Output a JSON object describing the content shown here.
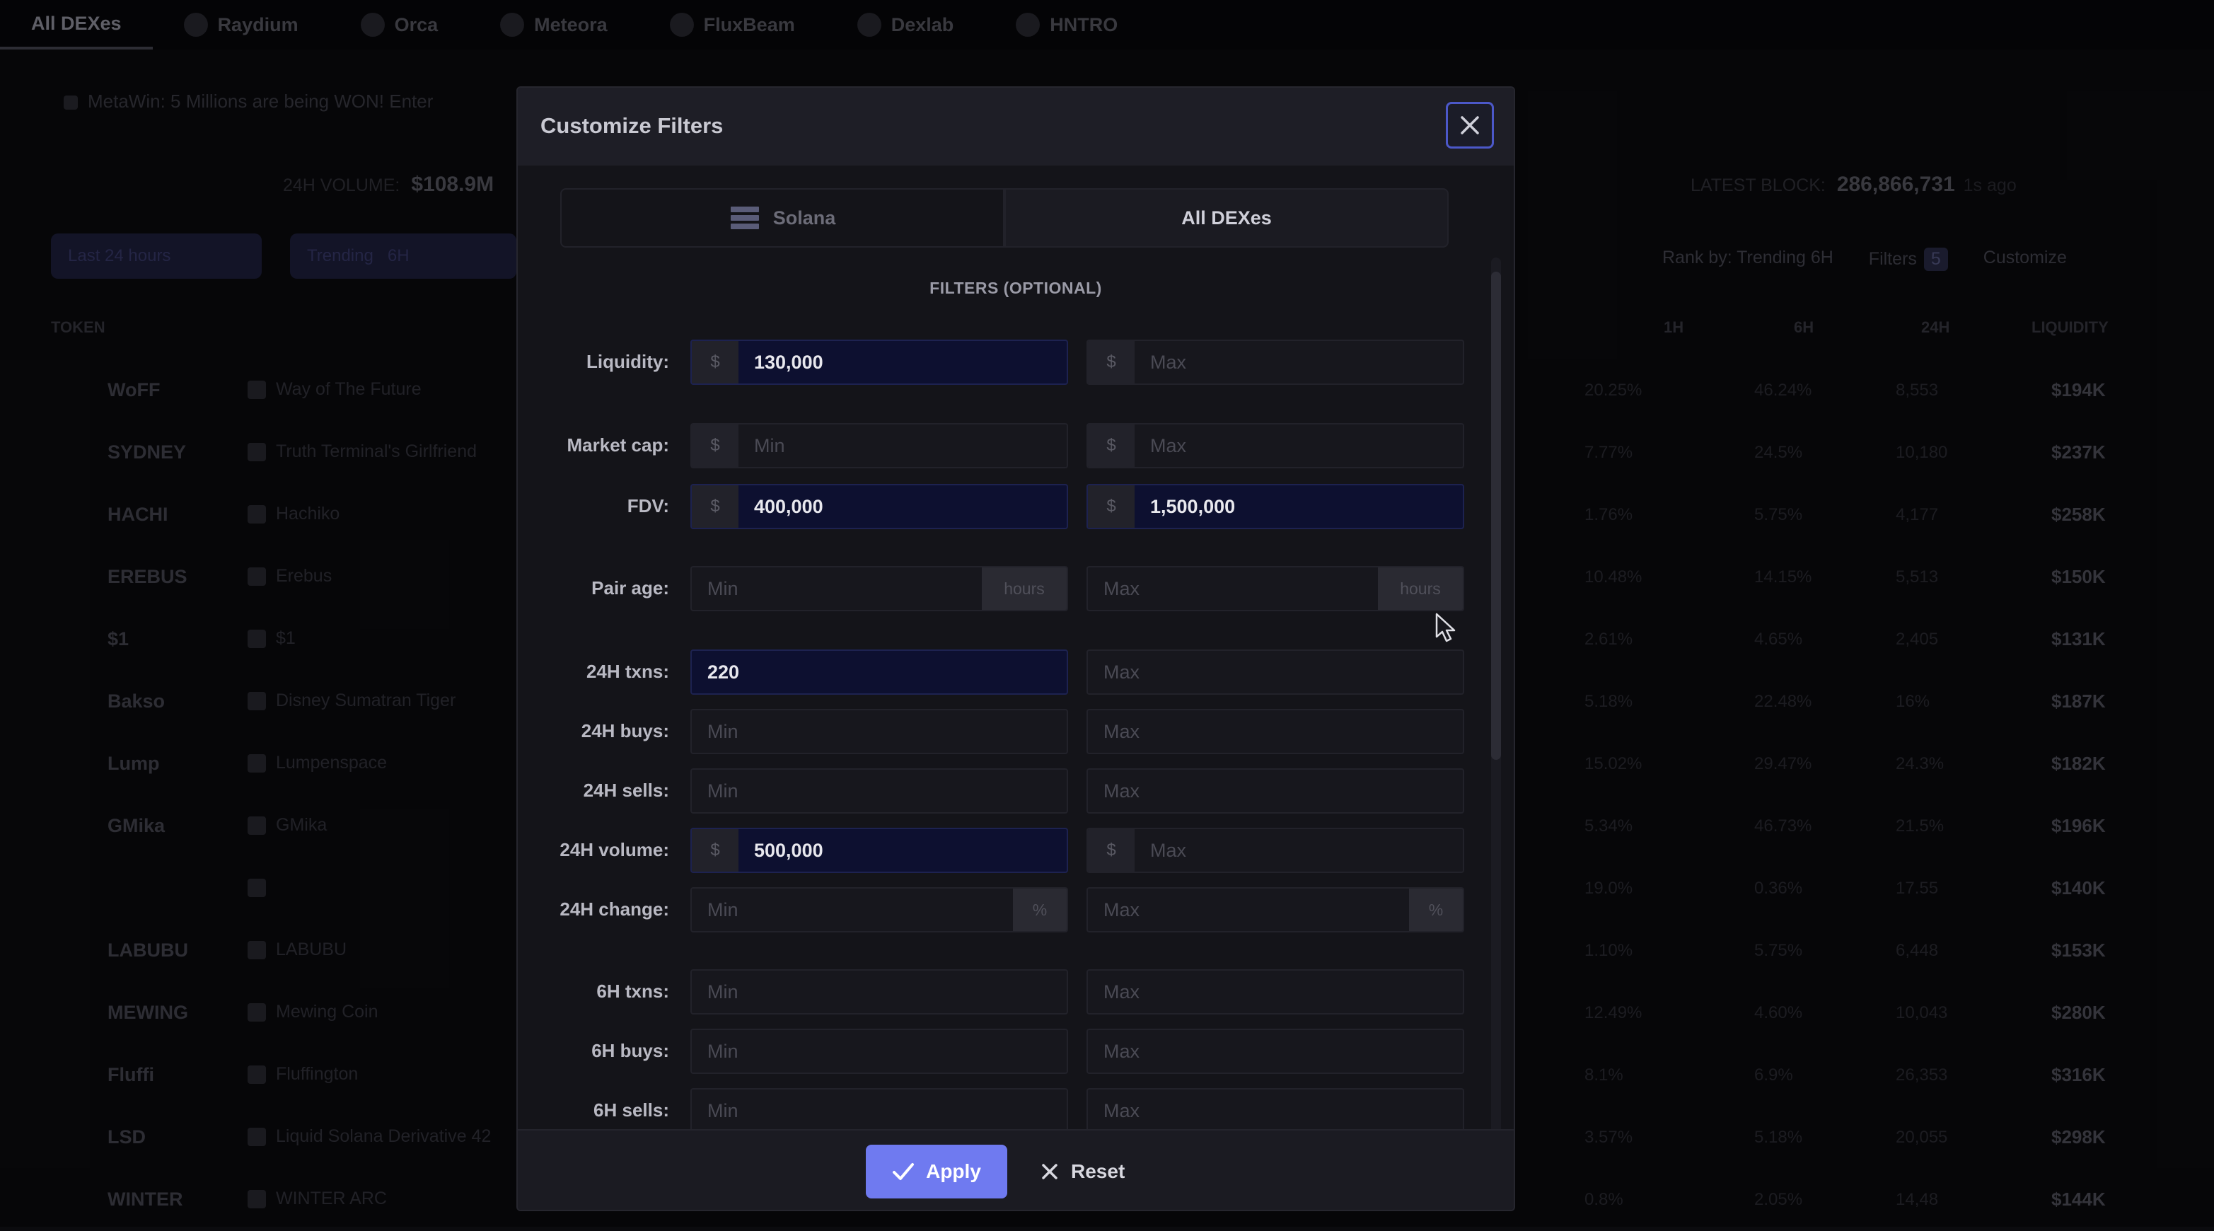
{
  "topnav": {
    "tabs": [
      {
        "label": "All DEXes",
        "active": true
      },
      {
        "label": "Raydium"
      },
      {
        "label": "Orca"
      },
      {
        "label": "Meteora"
      },
      {
        "label": "FluxBeam"
      },
      {
        "label": "Dexlab"
      },
      {
        "label": "HNTRO"
      }
    ]
  },
  "ticker": {
    "text": "MetaWin: 5 Millions are being WON! Enter"
  },
  "stats": {
    "volume_label": "24H VOLUME:",
    "volume_value": "$108.9M",
    "txns_label": "LATEST BLOCK:",
    "txns_value": "286,866,731",
    "txns_suffix": "1s ago"
  },
  "toolbar": {
    "timeframe": "Last 24 hours",
    "trending": "Trending",
    "trending_value": "6H",
    "rank_by": "Rank by: Trending 6H",
    "filters": "Filters",
    "filters_count": "5",
    "customize": "Customize"
  },
  "table": {
    "headers": {
      "token": "TOKEN",
      "c1": "1H",
      "c2": "6H",
      "c3": "24H",
      "liquidity": "LIQUIDITY"
    },
    "rows": [
      {
        "symbol": "WoFF",
        "name": "Way of The Future",
        "c1": "20.25%",
        "c2": "46.24%",
        "c3": "8,553",
        "liquidity": "$194K"
      },
      {
        "symbol": "SYDNEY",
        "name": "Truth Terminal's Girlfriend",
        "c1": "7.77%",
        "c2": "24.5%",
        "c3": "10,180",
        "liquidity": "$237K"
      },
      {
        "symbol": "HACHI",
        "name": "Hachiko",
        "c1": "1.76%",
        "c2": "5.75%",
        "c3": "4,177",
        "liquidity": "$258K"
      },
      {
        "symbol": "EREBUS",
        "name": "Erebus",
        "c1": "10.48%",
        "c2": "14.15%",
        "c3": "5,513",
        "liquidity": "$150K"
      },
      {
        "symbol": "$1",
        "name": "$1",
        "c1": "2.61%",
        "c2": "4.65%",
        "c3": "2,405",
        "liquidity": "$131K"
      },
      {
        "symbol": "Bakso",
        "name": "Disney Sumatran Tiger",
        "c1": "5.18%",
        "c2": "22.48%",
        "c3": "16%",
        "liquidity": "$187K"
      },
      {
        "symbol": "Lump",
        "name": "Lumpenspace",
        "c1": "15.02%",
        "c2": "29.47%",
        "c3": "24.3%",
        "liquidity": "$182K"
      },
      {
        "symbol": "GMika",
        "name": "GMika",
        "c1": "5.34%",
        "c2": "46.73%",
        "c3": "21.5%",
        "liquidity": "$196K"
      },
      {
        "symbol": "",
        "name": "",
        "c1": "19.0%",
        "c2": "0.36%",
        "c3": "17.55",
        "liquidity": "$140K"
      },
      {
        "symbol": "LABUBU",
        "name": "LABUBU",
        "c1": "1.10%",
        "c2": "5.75%",
        "c3": "6,448",
        "liquidity": "$153K"
      },
      {
        "symbol": "MEWING",
        "name": "Mewing Coin",
        "c1": "12.49%",
        "c2": "4.60%",
        "c3": "10,043",
        "liquidity": "$280K"
      },
      {
        "symbol": "Fluffi",
        "name": "Fluffington",
        "c1": "8.1%",
        "c2": "6.9%",
        "c3": "26,353",
        "liquidity": "$316K"
      },
      {
        "symbol": "LSD",
        "name": "Liquid Solana Derivative 42",
        "c1": "3.57%",
        "c2": "5.18%",
        "c3": "20,055",
        "liquidity": "$298K"
      },
      {
        "symbol": "WINTER",
        "name": "WINTER ARC",
        "c1": "0.8%",
        "c2": "2.05%",
        "c3": "14,48",
        "liquidity": "$144K"
      }
    ]
  },
  "modal": {
    "title": "Customize Filters",
    "chain_label": "Solana",
    "dex_label": "All DEXes",
    "section_label": "FILTERS (OPTIONAL)",
    "apply_label": "Apply",
    "reset_label": "Reset",
    "filters": [
      {
        "label": "Liquidity:",
        "prefix": "$",
        "min": "130,000",
        "max": "",
        "min_ph": "Min",
        "max_ph": "Max"
      },
      {
        "label": "Market cap:",
        "prefix": "$",
        "min": "",
        "max": "",
        "min_ph": "Min",
        "max_ph": "Max"
      },
      {
        "label": "FDV:",
        "prefix": "$",
        "min": "400,000",
        "max": "1,500,000",
        "min_ph": "Min",
        "max_ph": "Max"
      },
      {
        "label": "Pair age:",
        "suffix": "hours",
        "min": "",
        "max": "",
        "min_ph": "Min",
        "max_ph": "Max"
      },
      {
        "label": "24H txns:",
        "min": "220",
        "max": "",
        "min_ph": "Min",
        "max_ph": "Max"
      },
      {
        "label": "24H buys:",
        "min": "",
        "max": "",
        "min_ph": "Min",
        "max_ph": "Max"
      },
      {
        "label": "24H sells:",
        "min": "",
        "max": "",
        "min_ph": "Min",
        "max_ph": "Max"
      },
      {
        "label": "24H volume:",
        "prefix": "$",
        "min": "500,000",
        "max": "",
        "min_ph": "Min",
        "max_ph": "Max"
      },
      {
        "label": "24H change:",
        "suffix": "%",
        "min": "",
        "max": "",
        "min_ph": "Min",
        "max_ph": "Max"
      },
      {
        "label": "6H txns:",
        "min": "",
        "max": "",
        "min_ph": "Min",
        "max_ph": "Max"
      },
      {
        "label": "6H buys:",
        "min": "",
        "max": "",
        "min_ph": "Min",
        "max_ph": "Max"
      },
      {
        "label": "6H sells:",
        "min": "",
        "max": "",
        "min_ph": "Min",
        "max_ph": "Max"
      }
    ]
  },
  "colors": {
    "accent": "#6f7af0",
    "filled_input": "#0d1030",
    "close_border": "#4c58c9"
  }
}
